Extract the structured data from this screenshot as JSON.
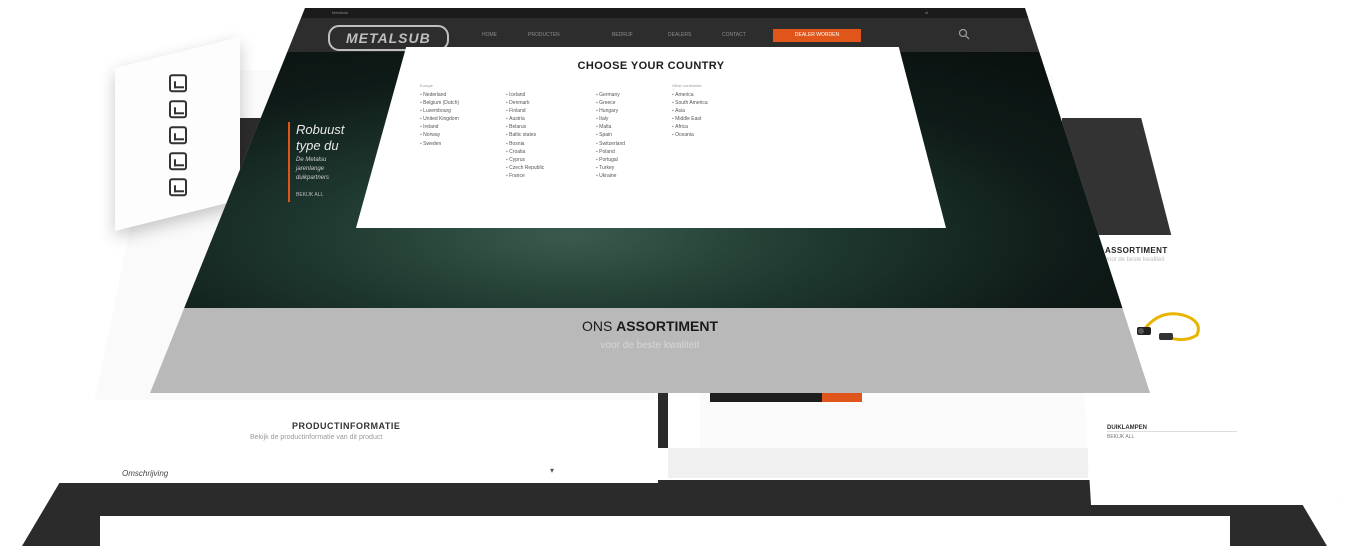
{
  "main_site": {
    "logo": "METALSUB",
    "topbar_text": "Metalsub",
    "topbar_right": "nl",
    "nav": [
      "HOME",
      "PRODUCTEN",
      "BEDRIJF",
      "DEALERS",
      "CONTACT"
    ],
    "nav_cta": "DEALER WORDEN",
    "hero": {
      "title": "Robuust\ntype du",
      "text": "De Metalsu\njarenlange\nduikpartners",
      "cta": "BEKIJK ALL"
    },
    "assortiment_title_light": "ONS ",
    "assortiment_title_bold": "ASSORTIMENT",
    "assortiment_sub": "voor de beste kwaliteit"
  },
  "modal": {
    "title": "CHOOSE YOUR COUNTRY",
    "columns": [
      {
        "heading": "Europe",
        "countries": [
          "Nederland",
          "Belgium (Dutch)",
          "Luxembourg",
          "United Kingdom",
          "Ireland",
          "Norway",
          "Sweden"
        ]
      },
      {
        "heading": "",
        "countries": [
          "Iceland",
          "Denmark",
          "Finland",
          "Austria",
          "Belarus",
          "Baltic states",
          "Bosnia",
          "Croatia",
          "Cyprus",
          "Czech Republic",
          "France"
        ]
      },
      {
        "heading": "",
        "countries": [
          "Germany",
          "Greece",
          "Hungary",
          "Italy",
          "Malta",
          "Spain",
          "Switzerland",
          "Poland",
          "Portugal",
          "Turkey",
          "Ukraine"
        ]
      },
      {
        "heading": "Other continents",
        "countries": [
          "America",
          "South America",
          "Asia",
          "Middle East",
          "Africa",
          "Oceania"
        ]
      }
    ]
  },
  "product_panel": {
    "title": "PRODUCTINFORMATIE",
    "subtitle": "Bekijk de productinformatie van dit product",
    "row_label": "Omschrijving",
    "row_chevron": "▾"
  },
  "right_panel": {
    "title": "ASSORTIMENT",
    "subtitle": "voor de beste kwaliteit",
    "label1": "DUIKLAMPEN",
    "label2": "BEKIJK ALL"
  },
  "icons": [
    "pdf-icon",
    "pdf-icon",
    "pdf-icon",
    "pdf-icon",
    "pdf-icon"
  ],
  "colors": {
    "accent": "#e0561a",
    "dark": "#2d2d2d",
    "hero": "#0f1b18"
  }
}
